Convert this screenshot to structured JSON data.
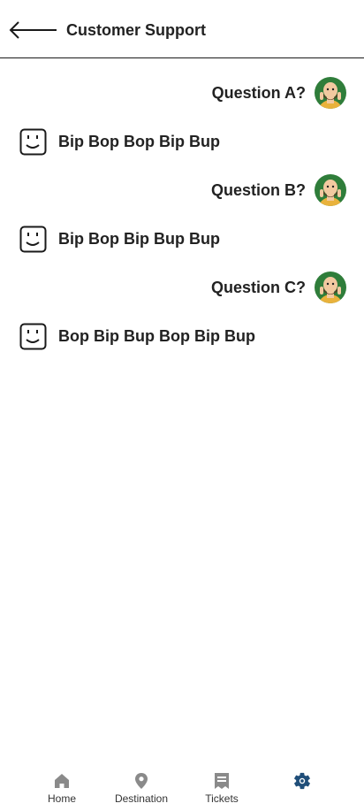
{
  "header": {
    "title": "Customer Support"
  },
  "conversation": [
    {
      "question": "Question A?",
      "answer": "Bip Bop Bop Bip Bup"
    },
    {
      "question": "Question B?",
      "answer": "Bip Bop Bip Bup Bup"
    },
    {
      "question": "Question C?",
      "answer": "Bop Bip Bup Bop Bip Bup"
    }
  ],
  "nav": {
    "items": [
      {
        "label": "Home",
        "icon": "home-icon"
      },
      {
        "label": "Destination",
        "icon": "location-pin-icon"
      },
      {
        "label": "Tickets",
        "icon": "ticket-icon"
      },
      {
        "label": "",
        "icon": "gear-icon"
      }
    ],
    "active_index": 3,
    "inactive_color": "#8a8a8a",
    "active_color": "#1f4e79"
  },
  "colors": {
    "avatar_bg": "#2f7d3a",
    "text": "#222222"
  }
}
